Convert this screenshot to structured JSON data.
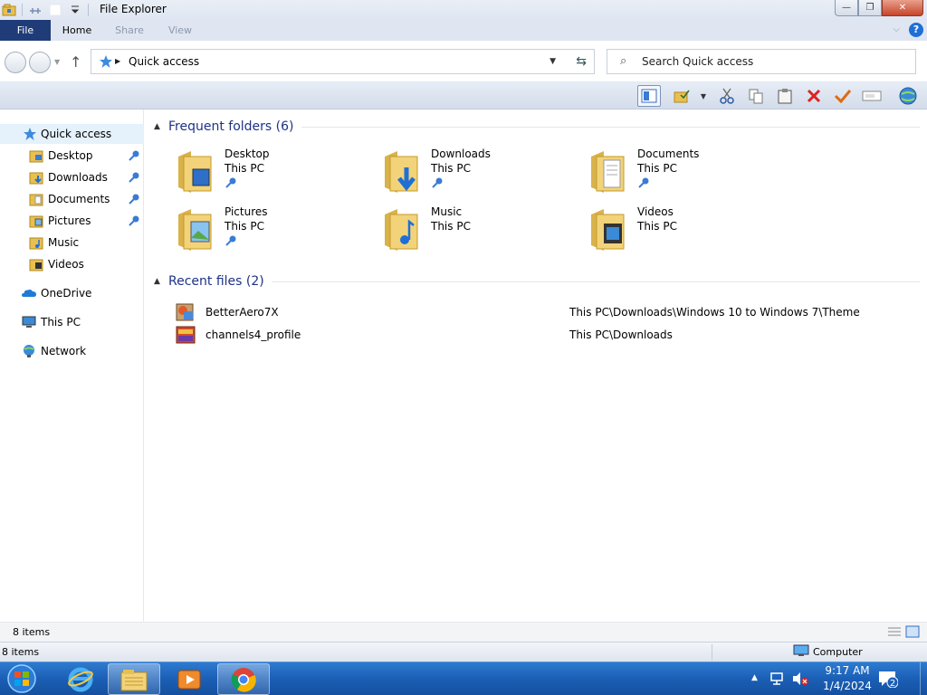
{
  "window": {
    "title": "File Explorer",
    "minimize_glyph": "—",
    "maximize_glyph": "❐",
    "close_glyph": "✕"
  },
  "ribbon": {
    "tabs": [
      "File",
      "Home",
      "Share",
      "View"
    ],
    "help_label": "?"
  },
  "address": {
    "path": "Quick access",
    "search_placeholder": "Search Quick access"
  },
  "navigation": {
    "items": [
      {
        "label": "Quick access",
        "icon": "star-icon",
        "selected": true,
        "pinned": false
      },
      {
        "label": "Desktop",
        "icon": "desktop-folder-icon",
        "pinned": true
      },
      {
        "label": "Downloads",
        "icon": "downloads-folder-icon",
        "pinned": true
      },
      {
        "label": "Documents",
        "icon": "documents-folder-icon",
        "pinned": true
      },
      {
        "label": "Pictures",
        "icon": "pictures-folder-icon",
        "pinned": true
      },
      {
        "label": "Music",
        "icon": "music-folder-icon",
        "pinned": false
      },
      {
        "label": "Videos",
        "icon": "videos-folder-icon",
        "pinned": false
      },
      {
        "label": "OneDrive",
        "icon": "onedrive-cloud-icon",
        "pinned": false
      },
      {
        "label": "This PC",
        "icon": "computer-icon",
        "pinned": false
      },
      {
        "label": "Network",
        "icon": "network-icon",
        "pinned": false
      }
    ]
  },
  "content": {
    "frequent_header": "Frequent folders (6)",
    "recent_header": "Recent files (2)",
    "frequent_folders": [
      {
        "name": "Desktop",
        "location": "This PC",
        "pinned": true,
        "icon": "desktop-folder-icon"
      },
      {
        "name": "Downloads",
        "location": "This PC",
        "pinned": true,
        "icon": "downloads-folder-icon"
      },
      {
        "name": "Documents",
        "location": "This PC",
        "pinned": true,
        "icon": "documents-folder-icon"
      },
      {
        "name": "Pictures",
        "location": "This PC",
        "pinned": true,
        "icon": "pictures-folder-icon"
      },
      {
        "name": "Music",
        "location": "This PC",
        "pinned": false,
        "icon": "music-folder-icon"
      },
      {
        "name": "Videos",
        "location": "This PC",
        "pinned": false,
        "icon": "videos-folder-icon"
      }
    ],
    "recent_files": [
      {
        "name": "BetterAero7X",
        "path": "This PC\\Downloads\\Windows 10 to Windows 7\\Theme",
        "icon": "theme-file-icon"
      },
      {
        "name": "channels4_profile",
        "path": "This PC\\Downloads",
        "icon": "image-file-icon"
      }
    ]
  },
  "status": {
    "item_count": "8 items",
    "bottom_item_count": "8 items",
    "zone": "Computer"
  },
  "taskbar": {
    "time": "9:17 AM",
    "date": "1/4/2024",
    "notification_count": "2",
    "apps": [
      "internet-explorer-icon",
      "file-explorer-icon",
      "media-player-icon",
      "chrome-icon"
    ]
  },
  "colors": {
    "accent": "#1f3c78",
    "group_header": "#1e3287",
    "taskbar": "#1b5fb6",
    "selection": "#e5f1fb"
  }
}
